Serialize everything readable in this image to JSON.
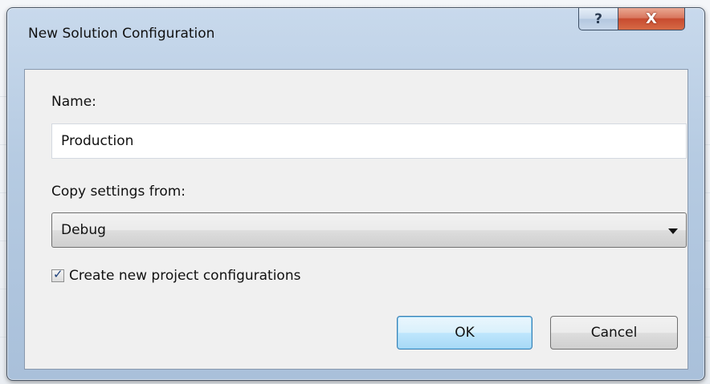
{
  "dialog": {
    "title": "New Solution Configuration",
    "help_glyph": "?",
    "close_glyph": "X",
    "name_label": "Name:",
    "name_value": "Production",
    "copy_label": "Copy settings from:",
    "copy_value": "Debug",
    "checkbox_label": "Create new project configurations",
    "checkbox_checked": true,
    "ok_label": "OK",
    "cancel_label": "Cancel"
  },
  "icons": {
    "help": "help-icon",
    "close": "close-icon",
    "dropdown": "chevron-down-icon",
    "check": "check-icon"
  },
  "colors": {
    "ok_border": "#3c7fb1",
    "close_button": "#c84b2f",
    "window_frame": "#b6cbe2"
  }
}
